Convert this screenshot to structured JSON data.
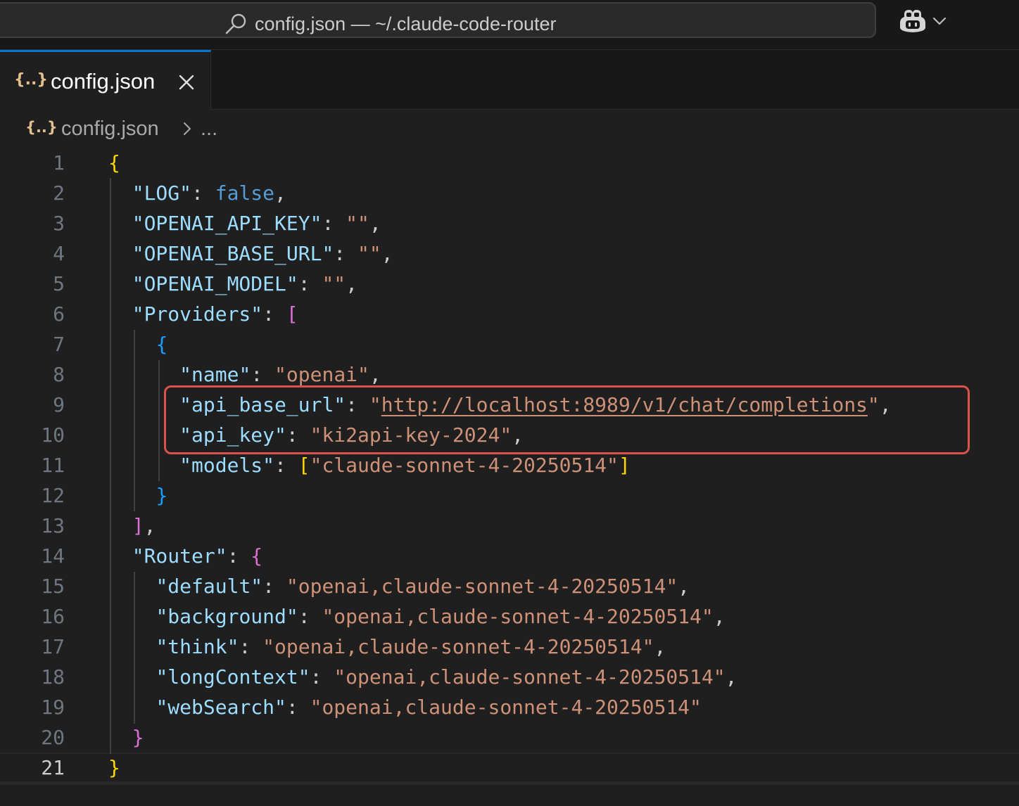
{
  "titlebar": {
    "title": "config.json — ~/.claude-code-router",
    "search_icon": "search-icon",
    "copilot_icon": "copilot-icon",
    "dropdown_icon": "chevron-down-icon"
  },
  "tab": {
    "icon_glyph": "{..}",
    "label": "config.json",
    "close_icon": "close-icon"
  },
  "breadcrumb": {
    "icon_glyph": "{..}",
    "file": "config.json",
    "more": "..."
  },
  "editor": {
    "current_line": "21",
    "highlight_lines": [
      "9",
      "10"
    ],
    "lines": [
      {
        "n": "1",
        "tokens": [
          {
            "t": "{",
            "c": "br1"
          }
        ]
      },
      {
        "n": "2",
        "tokens": [
          {
            "t": "  "
          },
          {
            "t": "\"LOG\"",
            "c": "k"
          },
          {
            "t": ": ",
            "c": "p"
          },
          {
            "t": "false",
            "c": "b"
          },
          {
            "t": ",",
            "c": "p"
          }
        ]
      },
      {
        "n": "3",
        "tokens": [
          {
            "t": "  "
          },
          {
            "t": "\"OPENAI_API_KEY\"",
            "c": "k"
          },
          {
            "t": ": ",
            "c": "p"
          },
          {
            "t": "\"\"",
            "c": "s"
          },
          {
            "t": ",",
            "c": "p"
          }
        ]
      },
      {
        "n": "4",
        "tokens": [
          {
            "t": "  "
          },
          {
            "t": "\"OPENAI_BASE_URL\"",
            "c": "k"
          },
          {
            "t": ": ",
            "c": "p"
          },
          {
            "t": "\"\"",
            "c": "s"
          },
          {
            "t": ",",
            "c": "p"
          }
        ]
      },
      {
        "n": "5",
        "tokens": [
          {
            "t": "  "
          },
          {
            "t": "\"OPENAI_MODEL\"",
            "c": "k"
          },
          {
            "t": ": ",
            "c": "p"
          },
          {
            "t": "\"\"",
            "c": "s"
          },
          {
            "t": ",",
            "c": "p"
          }
        ]
      },
      {
        "n": "6",
        "tokens": [
          {
            "t": "  "
          },
          {
            "t": "\"Providers\"",
            "c": "k"
          },
          {
            "t": ": ",
            "c": "p"
          },
          {
            "t": "[",
            "c": "br2"
          }
        ]
      },
      {
        "n": "7",
        "tokens": [
          {
            "t": "    "
          },
          {
            "t": "{",
            "c": "br3"
          }
        ]
      },
      {
        "n": "8",
        "tokens": [
          {
            "t": "      "
          },
          {
            "t": "\"name\"",
            "c": "k"
          },
          {
            "t": ": ",
            "c": "p"
          },
          {
            "t": "\"openai\"",
            "c": "s"
          },
          {
            "t": ",",
            "c": "p"
          }
        ]
      },
      {
        "n": "9",
        "tokens": [
          {
            "t": "      "
          },
          {
            "t": "\"api_base_url\"",
            "c": "k"
          },
          {
            "t": ": ",
            "c": "p"
          },
          {
            "t": "\"",
            "c": "s"
          },
          {
            "t": "http://localhost:8989/v1/chat/completions",
            "c": "u"
          },
          {
            "t": "\"",
            "c": "s"
          },
          {
            "t": ",",
            "c": "p"
          }
        ]
      },
      {
        "n": "10",
        "tokens": [
          {
            "t": "      "
          },
          {
            "t": "\"api_key\"",
            "c": "k"
          },
          {
            "t": ": ",
            "c": "p"
          },
          {
            "t": "\"ki2api-key-2024\"",
            "c": "s"
          },
          {
            "t": ",",
            "c": "p"
          }
        ]
      },
      {
        "n": "11",
        "tokens": [
          {
            "t": "      "
          },
          {
            "t": "\"models\"",
            "c": "k"
          },
          {
            "t": ": ",
            "c": "p"
          },
          {
            "t": "[",
            "c": "br1"
          },
          {
            "t": "\"claude-sonnet-4-20250514\"",
            "c": "s"
          },
          {
            "t": "]",
            "c": "br1"
          }
        ]
      },
      {
        "n": "12",
        "tokens": [
          {
            "t": "    "
          },
          {
            "t": "}",
            "c": "br3"
          }
        ]
      },
      {
        "n": "13",
        "tokens": [
          {
            "t": "  "
          },
          {
            "t": "]",
            "c": "br2"
          },
          {
            "t": ",",
            "c": "p"
          }
        ]
      },
      {
        "n": "14",
        "tokens": [
          {
            "t": "  "
          },
          {
            "t": "\"Router\"",
            "c": "k"
          },
          {
            "t": ": ",
            "c": "p"
          },
          {
            "t": "{",
            "c": "br2"
          }
        ]
      },
      {
        "n": "15",
        "tokens": [
          {
            "t": "    "
          },
          {
            "t": "\"default\"",
            "c": "k"
          },
          {
            "t": ": ",
            "c": "p"
          },
          {
            "t": "\"openai,claude-sonnet-4-20250514\"",
            "c": "s"
          },
          {
            "t": ",",
            "c": "p"
          }
        ]
      },
      {
        "n": "16",
        "tokens": [
          {
            "t": "    "
          },
          {
            "t": "\"background\"",
            "c": "k"
          },
          {
            "t": ": ",
            "c": "p"
          },
          {
            "t": "\"openai,claude-sonnet-4-20250514\"",
            "c": "s"
          },
          {
            "t": ",",
            "c": "p"
          }
        ]
      },
      {
        "n": "17",
        "tokens": [
          {
            "t": "    "
          },
          {
            "t": "\"think\"",
            "c": "k"
          },
          {
            "t": ": ",
            "c": "p"
          },
          {
            "t": "\"openai,claude-sonnet-4-20250514\"",
            "c": "s"
          },
          {
            "t": ",",
            "c": "p"
          }
        ]
      },
      {
        "n": "18",
        "tokens": [
          {
            "t": "    "
          },
          {
            "t": "\"longContext\"",
            "c": "k"
          },
          {
            "t": ": ",
            "c": "p"
          },
          {
            "t": "\"openai,claude-sonnet-4-20250514\"",
            "c": "s"
          },
          {
            "t": ",",
            "c": "p"
          }
        ]
      },
      {
        "n": "19",
        "tokens": [
          {
            "t": "    "
          },
          {
            "t": "\"webSearch\"",
            "c": "k"
          },
          {
            "t": ": ",
            "c": "p"
          },
          {
            "t": "\"openai,claude-sonnet-4-20250514\"",
            "c": "s"
          }
        ]
      },
      {
        "n": "20",
        "tokens": [
          {
            "t": "  "
          },
          {
            "t": "}",
            "c": "br2"
          }
        ]
      },
      {
        "n": "21",
        "tokens": [
          {
            "t": "}",
            "c": "br1"
          }
        ]
      }
    ]
  },
  "colors": {
    "editor_bg": "#1f1f1f",
    "key": "#9cdcfe",
    "string": "#ce9178",
    "boolean": "#569cd6",
    "bracket_gold": "#ffd700",
    "bracket_orchid": "#da70d6",
    "bracket_blue": "#179fff",
    "highlight_box": "#d9534a",
    "active_tab_accent": "#0078d4"
  }
}
